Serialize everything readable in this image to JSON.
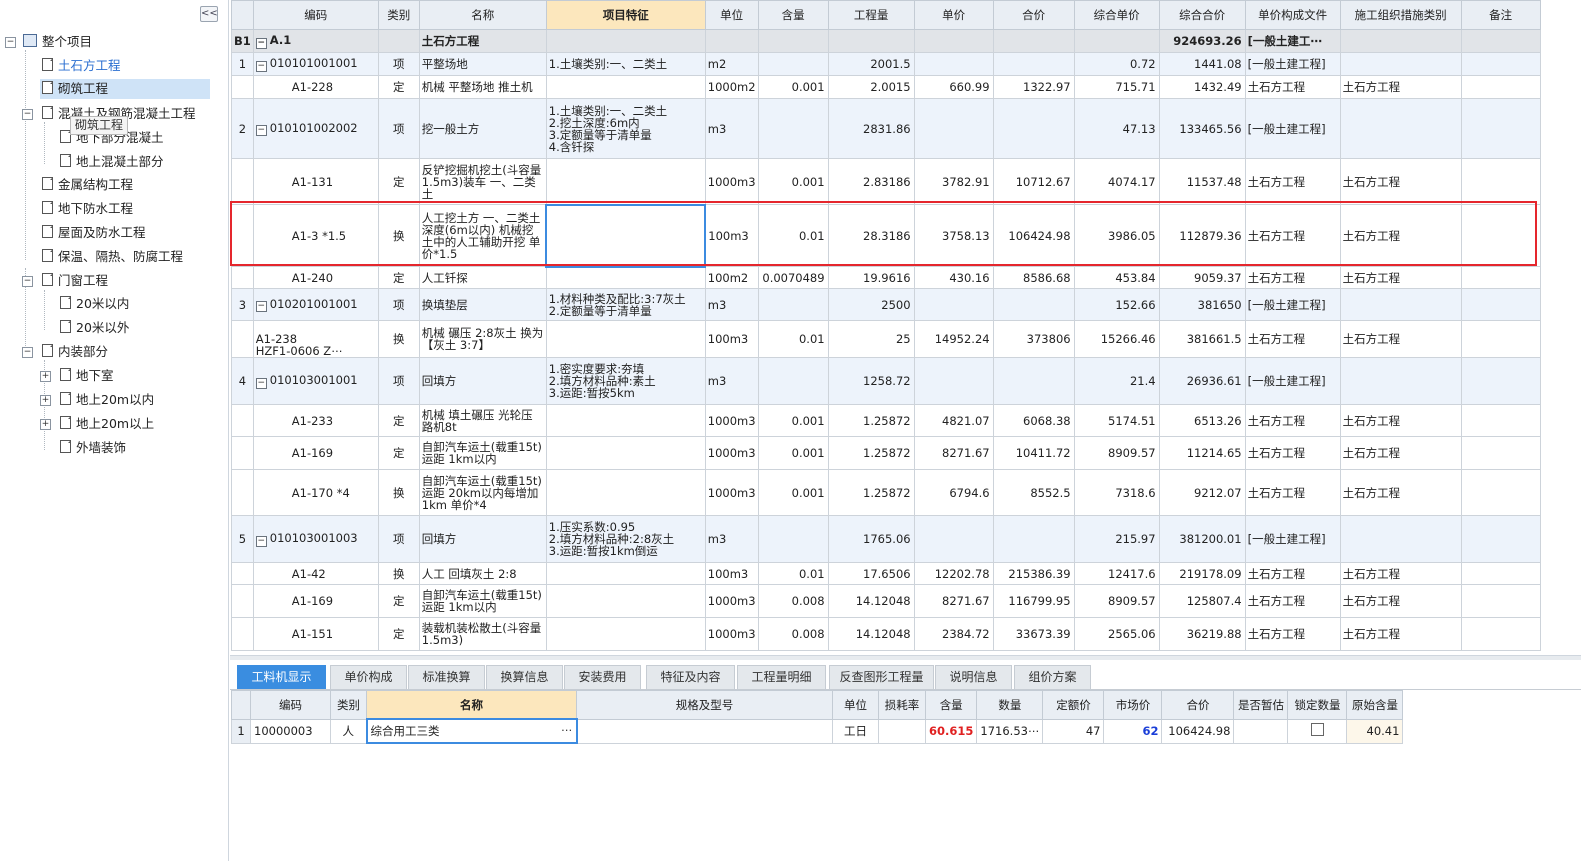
{
  "sidebar": {
    "collapse": "<<",
    "tooltip": "砌筑工程",
    "items": [
      {
        "label": "整个项目"
      },
      {
        "label": "土石方工程"
      },
      {
        "label": "砌筑工程"
      },
      {
        "label": "混凝土及钢筋混凝土工程"
      },
      {
        "label": "地下部分混凝土"
      },
      {
        "label": "地上混凝土部分"
      },
      {
        "label": "金属结构工程"
      },
      {
        "label": "地下防水工程"
      },
      {
        "label": "屋面及防水工程"
      },
      {
        "label": "保温、隔热、防腐工程"
      },
      {
        "label": "门窗工程"
      },
      {
        "label": "20米以内"
      },
      {
        "label": "20米以外"
      },
      {
        "label": "内装部分"
      },
      {
        "label": "地下室"
      },
      {
        "label": "地上20m以内"
      },
      {
        "label": "地上20m以上"
      },
      {
        "label": "外墙装饰"
      }
    ]
  },
  "grid": {
    "headers": [
      "",
      "编码",
      "类别",
      "名称",
      "项目特征",
      "单位",
      "含量",
      "工程量",
      "单价",
      "合价",
      "综合单价",
      "综合合价",
      "单价构成文件",
      "施工组织措施类别",
      "备注"
    ],
    "rows": [
      {
        "c": [
          "B1",
          "A.1",
          "",
          "土石方工程",
          "",
          "",
          "",
          "",
          "",
          "",
          "",
          "924693.26",
          "[一般土建工⋯",
          "",
          ""
        ]
      },
      {
        "c": [
          "1",
          "010101001001",
          "项",
          "平整场地",
          "1.土壤类别:一、二类土",
          "m2",
          "",
          "2001.5",
          "",
          "",
          "0.72",
          "1441.08",
          "[一般土建工程]",
          "",
          ""
        ]
      },
      {
        "c": [
          "",
          "A1-228",
          "定",
          "机械 平整场地 推土机",
          "",
          "1000m2",
          "0.001",
          "2.0015",
          "660.99",
          "1322.97",
          "715.71",
          "1432.49",
          "土石方工程",
          "土石方工程",
          ""
        ]
      },
      {
        "c": [
          "2",
          "010101002002",
          "项",
          "挖一般土方",
          "1.土壤类别:一、二类土\n2.挖土深度:6m内\n3.定额量等于清单量\n4.含钎探",
          "m3",
          "",
          "2831.86",
          "",
          "",
          "47.13",
          "133465.56",
          "[一般土建工程]",
          "",
          ""
        ]
      },
      {
        "c": [
          "",
          "A1-131",
          "定",
          "反铲挖掘机挖土(斗容量1.5m3)装车 一、二类土",
          "",
          "1000m3",
          "0.001",
          "2.83186",
          "3782.91",
          "10712.67",
          "4074.17",
          "11537.48",
          "土石方工程",
          "土石方工程",
          ""
        ]
      },
      {
        "c": [
          "",
          "A1-3 *1.5",
          "换",
          "人工挖土方 一、二类土 深度(6m以内) 机械挖土中的人工辅助开挖 单价*1.5",
          "",
          "100m3",
          "0.01",
          "28.3186",
          "3758.13",
          "106424.98",
          "3986.05",
          "112879.36",
          "土石方工程",
          "土石方工程",
          ""
        ]
      },
      {
        "c": [
          "",
          "A1-240",
          "定",
          "人工钎探",
          "",
          "100m2",
          "0.0070489",
          "19.9616",
          "430.16",
          "8586.68",
          "453.84",
          "9059.37",
          "土石方工程",
          "土石方工程",
          ""
        ]
      },
      {
        "c": [
          "3",
          "010201001001",
          "项",
          "换填垫层",
          "1.材料种类及配比:3:7灰土\n2.定额量等于清单量",
          "m3",
          "",
          "2500",
          "",
          "",
          "152.66",
          "381650",
          "[一般土建工程]",
          "",
          ""
        ]
      },
      {
        "c": [
          "",
          "A1-238\nHZF1-0606 Z⋯",
          "换",
          "机械 碾压 2:8灰土 换为【灰土 3:7】",
          "",
          "100m3",
          "0.01",
          "25",
          "14952.24",
          "373806",
          "15266.46",
          "381661.5",
          "土石方工程",
          "土石方工程",
          ""
        ]
      },
      {
        "c": [
          "4",
          "010103001001",
          "项",
          "回填方",
          "1.密实度要求:夯填\n2.填方材料品种:素土\n3.运距:暂按5km",
          "m3",
          "",
          "1258.72",
          "",
          "",
          "21.4",
          "26936.61",
          "[一般土建工程]",
          "",
          ""
        ]
      },
      {
        "c": [
          "",
          "A1-233",
          "定",
          "机械 填土碾压 光轮压路机8t",
          "",
          "1000m3",
          "0.001",
          "1.25872",
          "4821.07",
          "6068.38",
          "5174.51",
          "6513.26",
          "土石方工程",
          "土石方工程",
          ""
        ]
      },
      {
        "c": [
          "",
          "A1-169",
          "定",
          "自卸汽车运土(载重15t)运距 1km以内",
          "",
          "1000m3",
          "0.001",
          "1.25872",
          "8271.67",
          "10411.72",
          "8909.57",
          "11214.65",
          "土石方工程",
          "土石方工程",
          ""
        ]
      },
      {
        "c": [
          "",
          "A1-170 *4",
          "换",
          "自卸汽车运土(载重15t)运距 20km以内每增加1km 单价*4",
          "",
          "1000m3",
          "0.001",
          "1.25872",
          "6794.6",
          "8552.5",
          "7318.6",
          "9212.07",
          "土石方工程",
          "土石方工程",
          ""
        ]
      },
      {
        "c": [
          "5",
          "010103001003",
          "项",
          "回填方",
          "1.压实系数:0.95\n2.填方材料品种:2:8灰土\n3.运距:暂按1km倒运",
          "m3",
          "",
          "1765.06",
          "",
          "",
          "215.97",
          "381200.01",
          "[一般土建工程]",
          "",
          ""
        ]
      },
      {
        "c": [
          "",
          "A1-42",
          "换",
          "人工 回填灰土 2:8",
          "",
          "100m3",
          "0.01",
          "17.6506",
          "12202.78",
          "215386.39",
          "12417.6",
          "219178.09",
          "土石方工程",
          "土石方工程",
          ""
        ]
      },
      {
        "c": [
          "",
          "A1-169",
          "定",
          "自卸汽车运土(载重15t)运距 1km以内",
          "",
          "1000m3",
          "0.008",
          "14.12048",
          "8271.67",
          "116799.95",
          "8909.57",
          "125807.4",
          "土石方工程",
          "土石方工程",
          ""
        ]
      },
      {
        "c": [
          "",
          "A1-151",
          "定",
          "装载机装松散土(斗容量1.5m3)",
          "",
          "1000m3",
          "0.008",
          "14.12048",
          "2384.72",
          "33673.39",
          "2565.06",
          "36219.88",
          "土石方工程",
          "土石方工程",
          ""
        ]
      }
    ]
  },
  "tabs": [
    "工料机显示",
    "单价构成",
    "标准换算",
    "换算信息",
    "安装费用",
    "特征及内容",
    "工程量明细",
    "反查图形工程量",
    "说明信息",
    "组价方案"
  ],
  "bottom": {
    "headers": [
      "",
      "编码",
      "类别",
      "名称",
      "规格及型号",
      "单位",
      "损耗率",
      "含量",
      "数量",
      "定额价",
      "市场价",
      "合价",
      "是否暂估",
      "锁定数量",
      "原始含量"
    ],
    "row": [
      "1",
      "10000003",
      "人",
      "综合用工三类",
      "",
      "工日",
      "",
      "60.615",
      "1716.53⋯",
      "47",
      "62",
      "106424.98",
      "",
      "",
      "40.41"
    ],
    "ellipsis": "⋯"
  },
  "colors": {
    "accent": "#3a8de0",
    "highlight": "#e5262d",
    "link": "#2b6fd1"
  }
}
